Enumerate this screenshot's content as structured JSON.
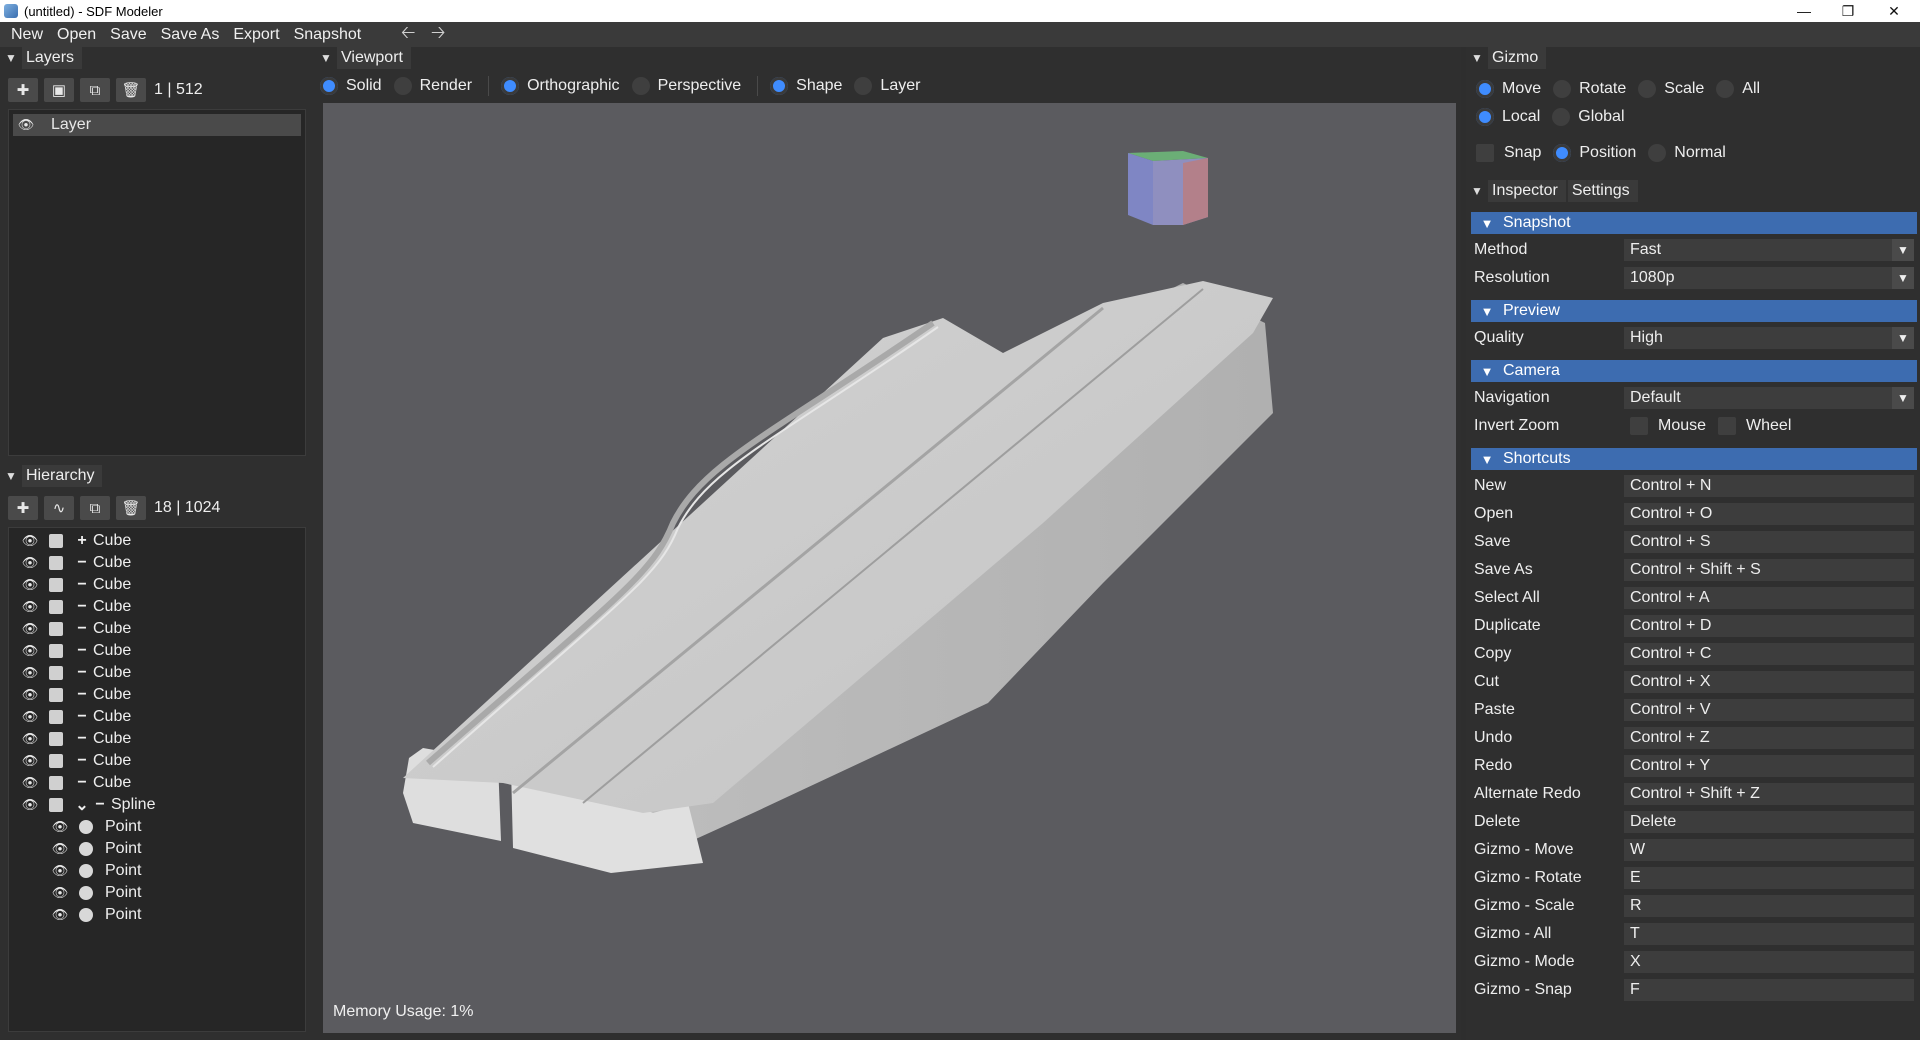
{
  "window": {
    "title": "(untitled) - SDF Modeler"
  },
  "menu": {
    "items": [
      "New",
      "Open",
      "Save",
      "Save As",
      "Export",
      "Snapshot"
    ]
  },
  "layers": {
    "title": "Layers",
    "count": "1 | 512",
    "items": [
      {
        "label": "Layer"
      }
    ]
  },
  "hierarchy": {
    "title": "Hierarchy",
    "count": "18 | 1024",
    "items": [
      {
        "label": "Cube",
        "op": "+",
        "depth": 0,
        "kind": "shape"
      },
      {
        "label": "Cube",
        "op": "−",
        "depth": 0,
        "kind": "shape"
      },
      {
        "label": "Cube",
        "op": "−",
        "depth": 0,
        "kind": "shape"
      },
      {
        "label": "Cube",
        "op": "−",
        "depth": 0,
        "kind": "shape"
      },
      {
        "label": "Cube",
        "op": "−",
        "depth": 0,
        "kind": "shape"
      },
      {
        "label": "Cube",
        "op": "−",
        "depth": 0,
        "kind": "shape"
      },
      {
        "label": "Cube",
        "op": "−",
        "depth": 0,
        "kind": "shape"
      },
      {
        "label": "Cube",
        "op": "−",
        "depth": 0,
        "kind": "shape"
      },
      {
        "label": "Cube",
        "op": "−",
        "depth": 0,
        "kind": "shape"
      },
      {
        "label": "Cube",
        "op": "−",
        "depth": 0,
        "kind": "shape"
      },
      {
        "label": "Cube",
        "op": "−",
        "depth": 0,
        "kind": "shape"
      },
      {
        "label": "Cube",
        "op": "−",
        "depth": 0,
        "kind": "shape"
      },
      {
        "label": "Spline",
        "op": "−",
        "depth": 0,
        "kind": "spline"
      },
      {
        "label": "Point",
        "op": "",
        "depth": 1,
        "kind": "point"
      },
      {
        "label": "Point",
        "op": "",
        "depth": 1,
        "kind": "point"
      },
      {
        "label": "Point",
        "op": "",
        "depth": 1,
        "kind": "point"
      },
      {
        "label": "Point",
        "op": "",
        "depth": 1,
        "kind": "point"
      },
      {
        "label": "Point",
        "op": "",
        "depth": 1,
        "kind": "point"
      }
    ]
  },
  "viewport": {
    "title": "Viewport",
    "render_mode": {
      "solid": "Solid",
      "render": "Render"
    },
    "projection": {
      "ortho": "Orthographic",
      "persp": "Perspective"
    },
    "display": {
      "shape": "Shape",
      "layer": "Layer"
    },
    "memory": "Memory Usage: 1%"
  },
  "gizmo": {
    "title": "Gizmo",
    "modes": {
      "move": "Move",
      "rotate": "Rotate",
      "scale": "Scale",
      "all": "All"
    },
    "space": {
      "local": "Local",
      "global": "Global"
    },
    "snap": {
      "snap": "Snap",
      "position": "Position",
      "normal": "Normal"
    }
  },
  "inspector": {
    "tab_inspector": "Inspector",
    "tab_settings": "Settings",
    "snapshot": {
      "title": "Snapshot",
      "method_label": "Method",
      "method_value": "Fast",
      "resolution_label": "Resolution",
      "resolution_value": "1080p"
    },
    "preview": {
      "title": "Preview",
      "quality_label": "Quality",
      "quality_value": "High"
    },
    "camera": {
      "title": "Camera",
      "navigation_label": "Navigation",
      "navigation_value": "Default",
      "invert_label": "Invert Zoom",
      "mouse": "Mouse",
      "wheel": "Wheel"
    },
    "shortcuts": {
      "title": "Shortcuts",
      "items": [
        {
          "label": "New",
          "value": "Control + N"
        },
        {
          "label": "Open",
          "value": "Control + O"
        },
        {
          "label": "Save",
          "value": "Control + S"
        },
        {
          "label": "Save As",
          "value": "Control + Shift + S"
        },
        {
          "label": "Select All",
          "value": "Control + A"
        },
        {
          "label": "Duplicate",
          "value": "Control + D"
        },
        {
          "label": "Copy",
          "value": "Control + C"
        },
        {
          "label": "Cut",
          "value": "Control + X"
        },
        {
          "label": "Paste",
          "value": "Control + V"
        },
        {
          "label": "Undo",
          "value": "Control + Z"
        },
        {
          "label": "Redo",
          "value": "Control + Y"
        },
        {
          "label": "Alternate Redo",
          "value": "Control + Shift + Z"
        },
        {
          "label": "Delete",
          "value": "Delete"
        },
        {
          "label": "Gizmo - Move",
          "value": "W"
        },
        {
          "label": "Gizmo - Rotate",
          "value": "E"
        },
        {
          "label": "Gizmo - Scale",
          "value": "R"
        },
        {
          "label": "Gizmo - All",
          "value": "T"
        },
        {
          "label": "Gizmo - Mode",
          "value": "X"
        },
        {
          "label": "Gizmo - Snap",
          "value": "F"
        }
      ]
    }
  },
  "colors": {
    "accent": "#3f8cff",
    "section": "#3d6cb0"
  }
}
